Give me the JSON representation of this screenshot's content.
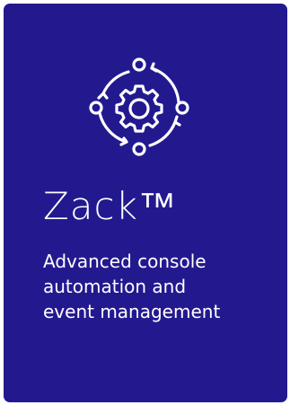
{
  "card": {
    "background": "#23198f",
    "text_color": "#ffffff"
  },
  "icon": {
    "name": "automation-cycle-gear-icon"
  },
  "product": {
    "title": "Zack™",
    "description_lines": [
      "Advanced console",
      "automation and",
      "event management"
    ]
  }
}
